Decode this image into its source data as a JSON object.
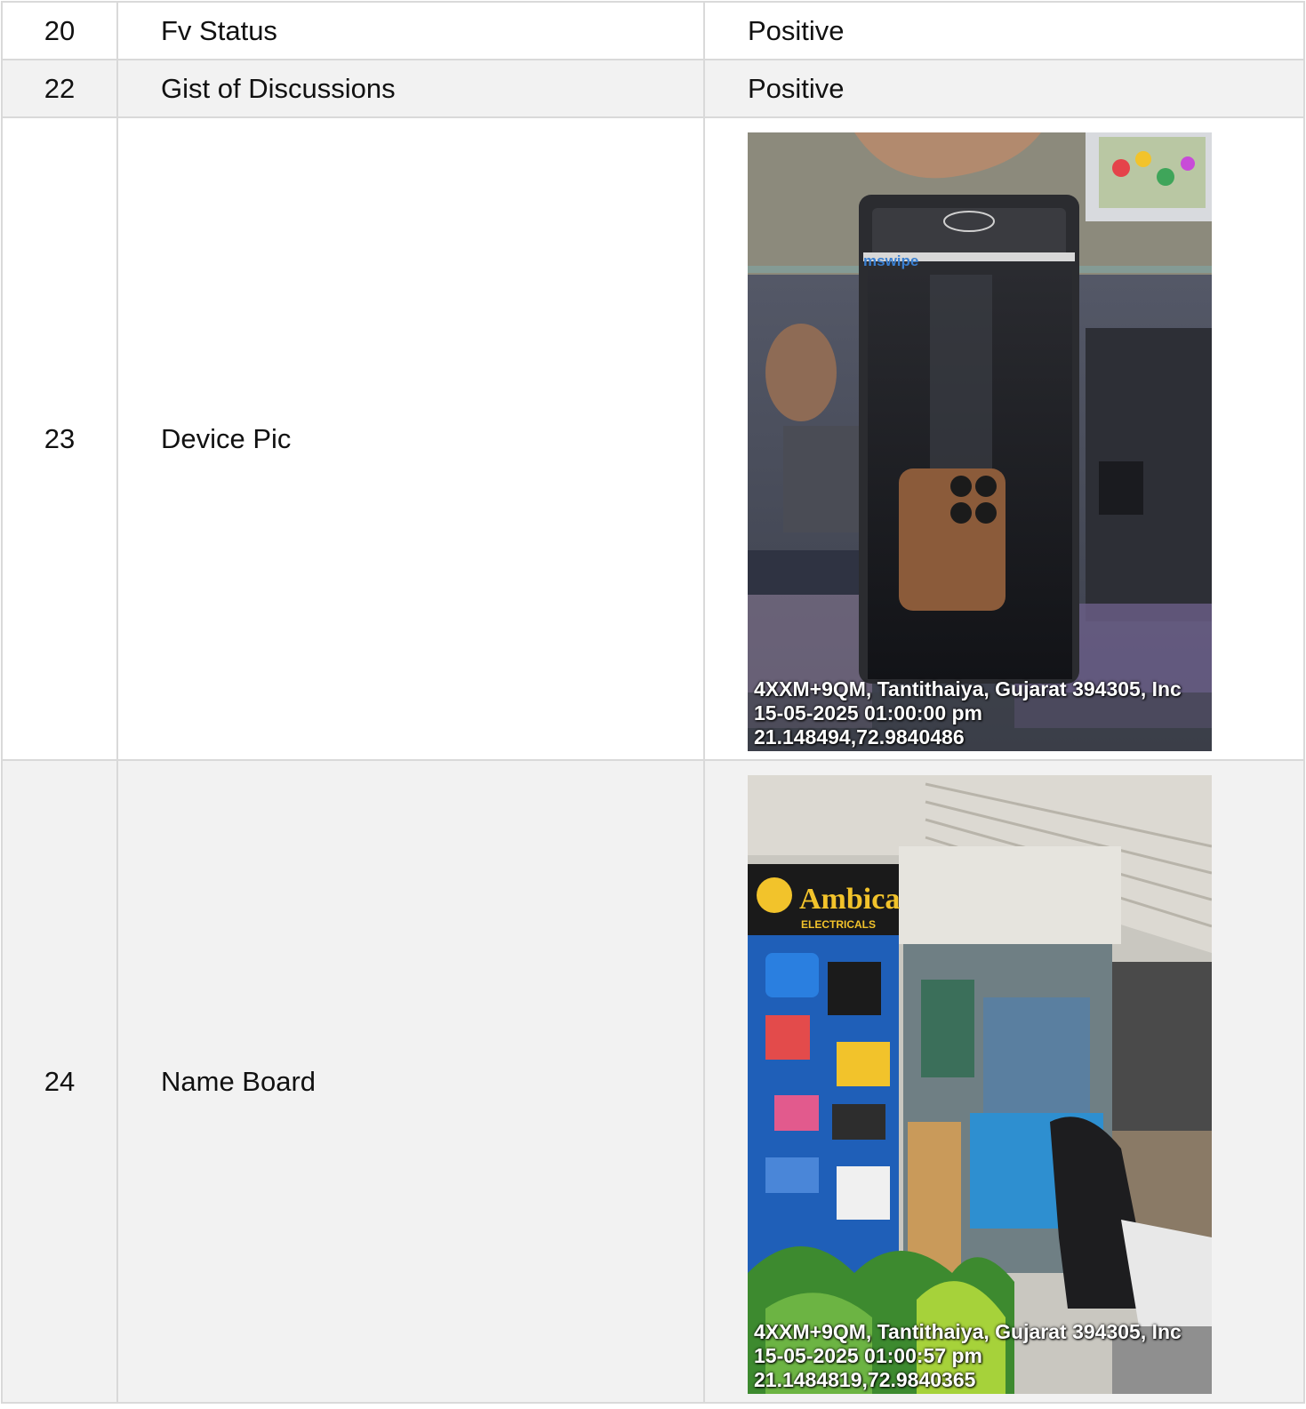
{
  "rows": [
    {
      "num": "20",
      "label": "Fv Status",
      "value": "Positive"
    },
    {
      "num": "22",
      "label": "Gist of Discussions",
      "value": "Positive"
    },
    {
      "num": "23",
      "label": "Device Pic",
      "photo": {
        "subject": "mswipe POS device on glass counter",
        "brand_text": "mswipe",
        "geotag": {
          "address": "4XXM+9QM, Tantithaiya, Gujarat 394305, Inc",
          "datetime": "15-05-2025 01:00:00 pm",
          "coords": "21.148494,72.9840486"
        }
      }
    },
    {
      "num": "24",
      "label": "Name Board",
      "photo": {
        "subject": "Ambica Electricals shop front",
        "brand_text": "Ambica",
        "brand_sub": "ELECTRICALS",
        "geotag": {
          "address": "4XXM+9QM, Tantithaiya, Gujarat 394305, Inc",
          "datetime": "15-05-2025 01:00:57 pm",
          "coords": "21.1484819,72.9840365"
        }
      }
    }
  ]
}
